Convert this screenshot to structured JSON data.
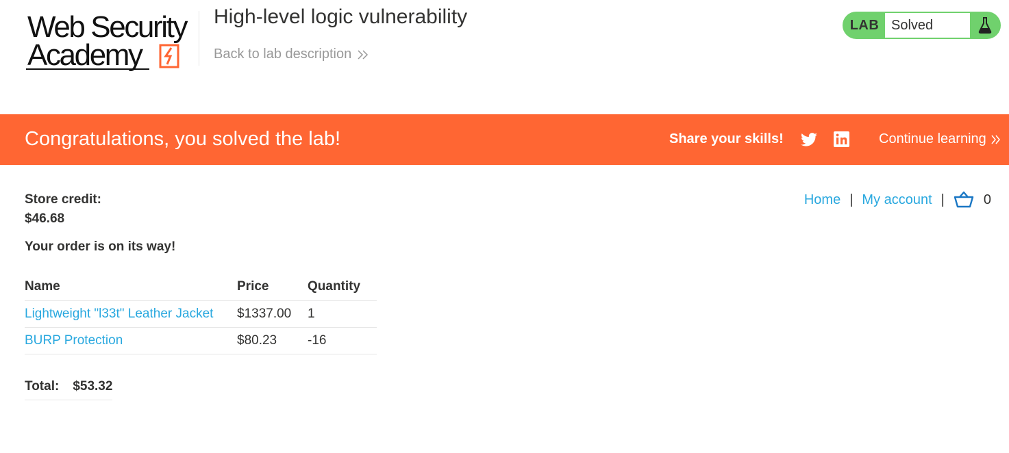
{
  "header": {
    "logo_line1": "Web Security",
    "logo_line2": "Academy",
    "lab_title": "High-level logic vulnerability",
    "back_link": "Back to lab description",
    "lab_badge": "LAB",
    "lab_status": "Solved"
  },
  "banner": {
    "message": "Congratulations, you solved the lab!",
    "share_label": "Share your skills!",
    "continue_link": "Continue learning"
  },
  "nav": {
    "home": "Home",
    "separator": "|",
    "my_account": "My account",
    "cart_count": "0"
  },
  "store": {
    "credit_label": "Store credit:",
    "credit_value": "$46.68",
    "order_message": "Your order is on its way!"
  },
  "order_table": {
    "headers": [
      "Name",
      "Price",
      "Quantity"
    ],
    "rows": [
      {
        "name": "Lightweight \"l33t\" Leather Jacket",
        "price": "$1337.00",
        "quantity": "1"
      },
      {
        "name": "BURP Protection",
        "price": "$80.23",
        "quantity": "-16"
      }
    ]
  },
  "total": {
    "label": "Total:",
    "value": "$53.32"
  },
  "icons": {
    "logo": "lightning-bolt-icon",
    "back": "double-chevron-right-icon",
    "flask": "flask-icon",
    "twitter": "twitter-icon",
    "linkedin": "linkedin-icon",
    "cart": "cart-icon"
  },
  "colors": {
    "brand_orange": "#ff6633",
    "solved_green": "#70d16d",
    "link_blue": "#29a8df",
    "text_dark": "#333332",
    "muted_gray": "#999999"
  }
}
